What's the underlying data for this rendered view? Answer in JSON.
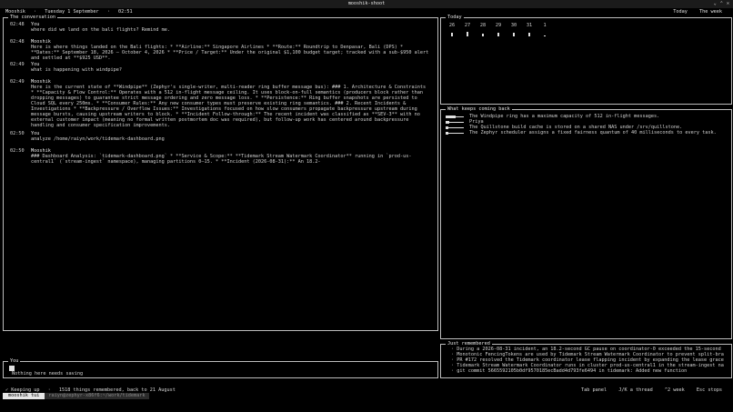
{
  "window": {
    "title": "mooshik-shoot",
    "controls": [
      "⌄",
      "⌃",
      "✕"
    ]
  },
  "topbar": {
    "app": "Mooshik",
    "sep": "·",
    "date": "Tuesday 1 September",
    "time": "02:51",
    "views": [
      "Today",
      "The week"
    ]
  },
  "conversation": {
    "title": "The conversation",
    "messages": [
      {
        "time": "02:48",
        "speaker": "You",
        "text": "where did we land on the bali flights? Remind me."
      },
      {
        "time": "02:48",
        "speaker": "Mooshik",
        "text": "Here is where things landed on the Bali flights: * **Airline:** Singapore Airlines * **Route:** Roundtrip to Denpasar, Bali (DPS) * **Dates:** September 18, 2026 – October 4, 2026 * **Price / Target:** Under the original $1,100 budget target; tracked with a sub-$950 alert and settled at **$925 USD**."
      },
      {
        "time": "02:49",
        "speaker": "You",
        "text": "what is happening with windpipe?"
      },
      {
        "time": "02:49",
        "speaker": "Mooshik",
        "text": "Here is the current state of **Windpipe** (Zephyr's single-writer, multi-reader ring buffer message bus): ### 1. Architecture & Constraints * **Capacity & Flow Control:** Operates with a 512 in-flight message ceiling. It uses block-on-full semantics (producers block rather than dropping messages) to guarantee strict message ordering and zero message loss. * **Persistence:** Ring buffer snapshots are persisted to Cloud SQL every 250ms. * **Consumer Rules:** Any new consumer types must preserve existing ring semantics. ### 2. Recent Incidents & Investigations * **Backpressure / Overflow Issues:** Investigations focused on how slow consumers propagate backpressure upstream during message bursts, causing upstream writers to block. * **Incident Follow-through:** The recent incident was classified as **SEV-3** with no external customer impact (meaning no formal written postmortem doc was required), but follow-up work has centered around backpressure handling and consumer specification improvements."
      },
      {
        "time": "02:50",
        "speaker": "You",
        "text": "analyze /home/raiyn/work/tidemark-dashboard.png"
      },
      {
        "time": "02:50",
        "speaker": "Mooshik",
        "text": "### Dashboard Analysis: `tidemark-dashboard.png` * **Service & Scope:** **Tidemark Stream Watermark Coordinator** running in `prod-us-central1` (`stream-ingest` namespace), managing partitions 0–15. * **Incident (2026-08-31):** An 18.2-"
      }
    ]
  },
  "you": {
    "title": "You",
    "status": "Nothing here needs saving"
  },
  "today": {
    "title": "Today",
    "days": [
      {
        "label": "26",
        "level": 0.55
      },
      {
        "label": "27",
        "level": 0.65
      },
      {
        "label": "28",
        "level": 0.4
      },
      {
        "label": "29",
        "level": 0.45
      },
      {
        "label": "30",
        "level": 0.45
      },
      {
        "label": "31",
        "level": 0.55
      },
      {
        "label": "1",
        "level": 0.15
      }
    ]
  },
  "coming_back": {
    "title": "What keeps coming back",
    "items": [
      {
        "text": "The Windpipe ring has a maximum capacity of 512 in-flight messages.",
        "level": 0.55
      },
      {
        "text": "Priya",
        "level": 0.2
      },
      {
        "text": "The Quillstone build cache is stored on a shared NAS under /srv/quillstone.",
        "level": 0.15
      },
      {
        "text": "The Zephyr scheduler assigns a fixed fairness quantum of 40 milliseconds to every task.",
        "level": 0.15
      }
    ]
  },
  "just_remembered": {
    "title": "Just remembered",
    "items": [
      "· During a 2026-08-31 incident, an 18.2-second GC pause on coordinator-0 exceeded the 15-second lease…",
      "· Monotonic FencingTokens are used by Tidemark Stream Watermark Coordinator to prevent split-brain writes…",
      "· PR #172 resolved the Tidemark coordinator lease flapping incident by expanding the lease grace window to…",
      "· Tidemark Stream Watermark Coordinator runs in cluster prod-us-central1 in the stream-ingest namespace…",
      "· git commit 5665592105b0df9570185ecBadd4d793fe6494 in tidemark: Added new function"
    ]
  },
  "statusbar": {
    "left": [
      "✓ Keeping up",
      "·",
      "1518 things remembered, back to 21 August"
    ],
    "right": [
      "Tab panel",
      "J/K a thread",
      "^2 week",
      "Esc stops"
    ]
  },
  "tmux": {
    "session": "mooshik tui",
    "path": "raiyn@zephyr-x86f6:~/work/tidemark"
  }
}
